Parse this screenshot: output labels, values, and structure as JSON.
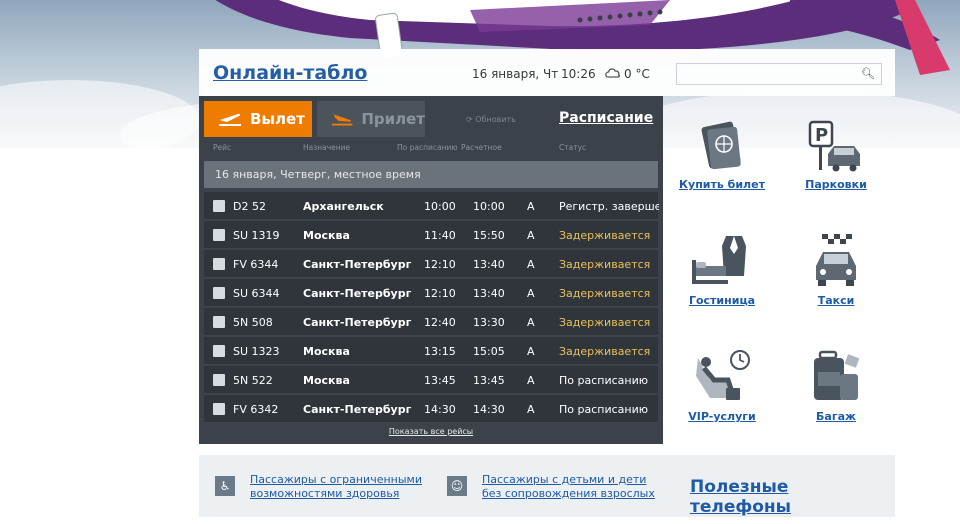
{
  "header": {
    "title": "Онлайн-табло",
    "date": "16 января, Чт",
    "time": "10:26",
    "temperature": "0 °C",
    "search_placeholder": ""
  },
  "board": {
    "tab_departure": "Вылет",
    "tab_arrival": "Прилет",
    "refresh": "Обновить",
    "schedule": "Расписание",
    "columns": [
      "Рейс",
      "Назначение",
      "По расписанию",
      "Расчетное",
      "Статус"
    ],
    "day_row": "16 января, Четверг, местное время",
    "flights": [
      {
        "flight": "D2 52",
        "dest": "Архангельск",
        "sched": "10:00",
        "est": "10:00",
        "term": "A",
        "status": "Регистр. завершена",
        "delayed": false
      },
      {
        "flight": "SU 1319",
        "dest": "Москва",
        "sched": "11:40",
        "est": "15:50",
        "term": "A",
        "status": "Задерживается",
        "delayed": true
      },
      {
        "flight": "FV 6344",
        "dest": "Санкт-Петербург",
        "sched": "12:10",
        "est": "13:40",
        "term": "A",
        "status": "Задерживается",
        "delayed": true
      },
      {
        "flight": "SU 6344",
        "dest": "Санкт-Петербург",
        "sched": "12:10",
        "est": "13:40",
        "term": "A",
        "status": "Задерживается",
        "delayed": true
      },
      {
        "flight": "5N 508",
        "dest": "Санкт-Петербург",
        "sched": "12:40",
        "est": "13:30",
        "term": "A",
        "status": "Задерживается",
        "delayed": true
      },
      {
        "flight": "SU 1323",
        "dest": "Москва",
        "sched": "13:15",
        "est": "15:05",
        "term": "A",
        "status": "Задерживается",
        "delayed": true
      },
      {
        "flight": "5N 522",
        "dest": "Москва",
        "sched": "13:45",
        "est": "13:45",
        "term": "A",
        "status": "По расписанию",
        "delayed": false
      },
      {
        "flight": "FV 6342",
        "dest": "Санкт-Петербург",
        "sched": "14:30",
        "est": "14:30",
        "term": "A",
        "status": "По расписанию",
        "delayed": false
      }
    ],
    "show_all": "Показать все рейсы"
  },
  "services": {
    "buy_ticket": "Купить билет",
    "parking": "Парковки",
    "hotel": "Гостиница",
    "taxi": "Такси",
    "vip": "VIP-услуги",
    "baggage": "Багаж"
  },
  "bottom": {
    "reduced_mobility_1": "Пассажиры с ограниченными",
    "reduced_mobility_2": "возможностями здоровья",
    "children_1": "Пассажиры с детьми и дети",
    "children_2": "без сопровождения взрослых",
    "phones": "Полезные телефоны"
  },
  "colors": {
    "accent_orange": "#ee7c00",
    "link_blue": "#1f5aa6",
    "board_dark": "#3b4249",
    "delayed_yellow": "#e8c15a"
  }
}
